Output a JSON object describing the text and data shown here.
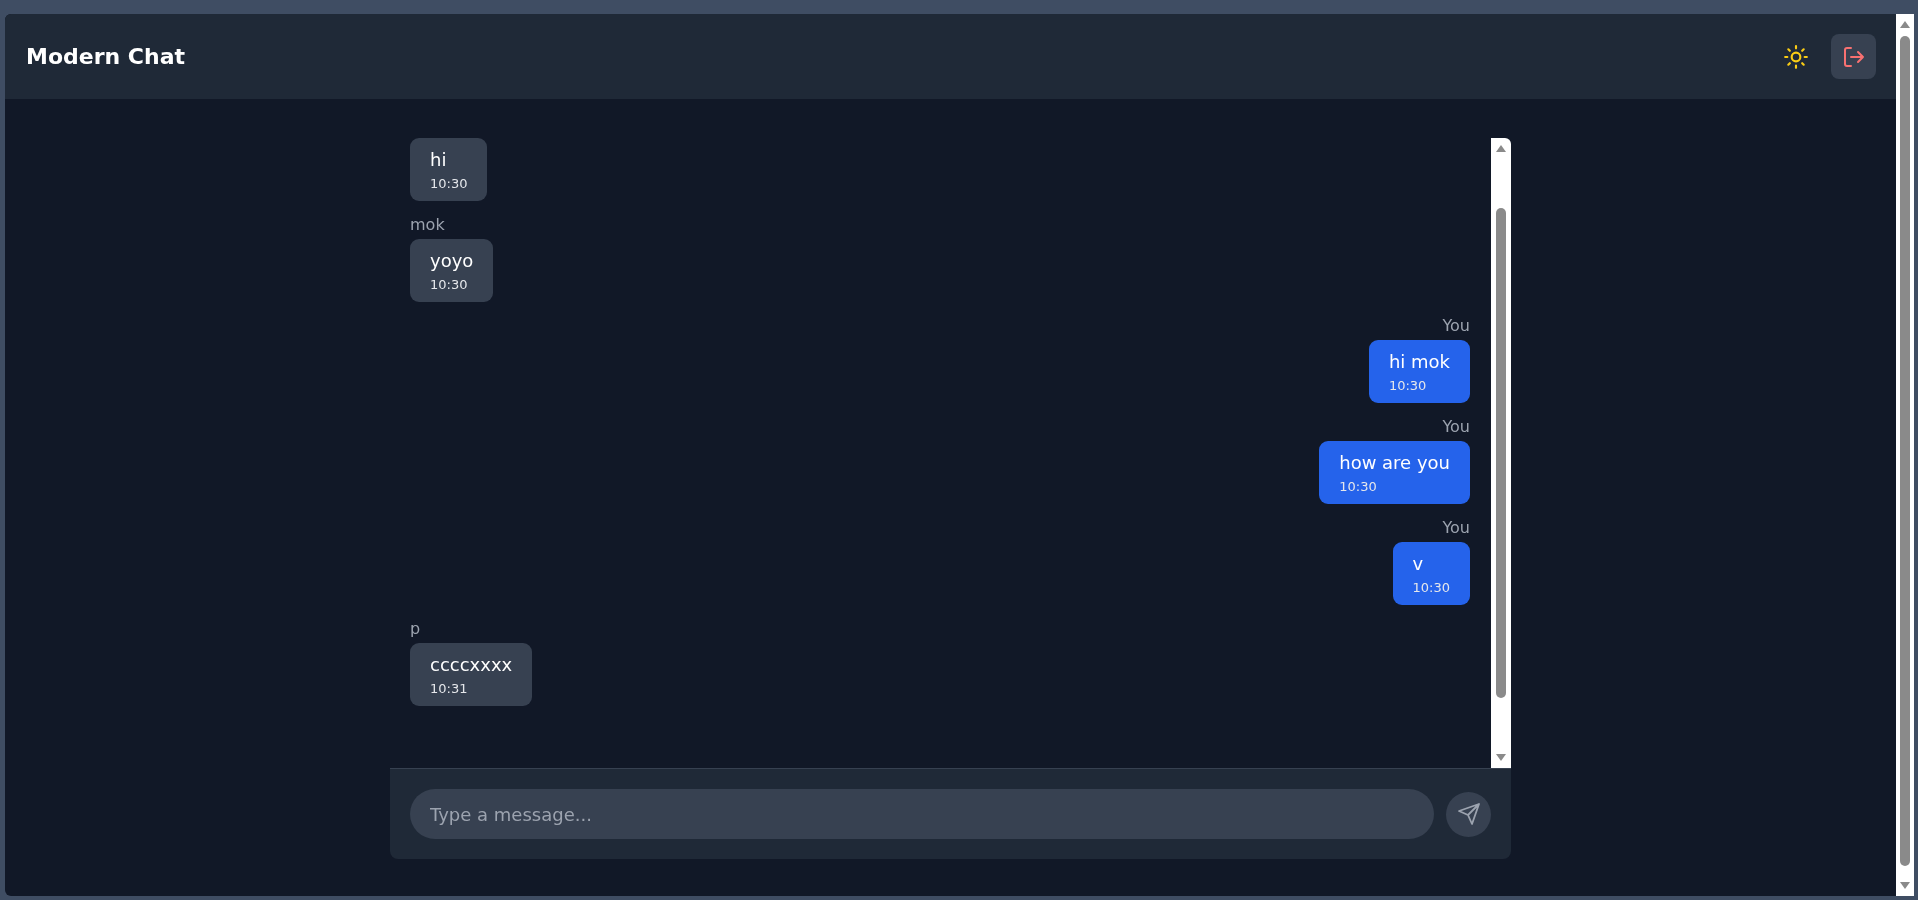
{
  "header": {
    "title": "Modern Chat"
  },
  "messages": [
    {
      "kind": "received",
      "text": "hi",
      "time": "10:30"
    },
    {
      "kind": "received",
      "sender": "mok",
      "text": "yoyo",
      "time": "10:30"
    },
    {
      "kind": "sent",
      "sender": "You",
      "text": "hi mok",
      "time": "10:30"
    },
    {
      "kind": "sent",
      "sender": "You",
      "text": "how are you",
      "time": "10:30"
    },
    {
      "kind": "sent",
      "sender": "You",
      "text": "v",
      "time": "10:30"
    },
    {
      "kind": "received",
      "sender": "p",
      "text": "ccccxxxx",
      "time": "10:31"
    }
  ],
  "composer": {
    "placeholder": "Type a message..."
  }
}
